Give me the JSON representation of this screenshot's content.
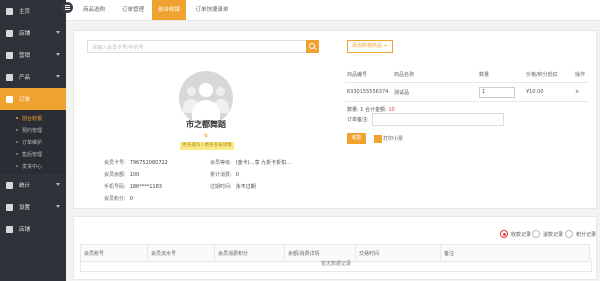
{
  "sidebar": {
    "items": [
      {
        "label": "主页"
      },
      {
        "label": "店铺"
      },
      {
        "label": "营销"
      },
      {
        "label": "产品"
      },
      {
        "label": "订单"
      },
      {
        "label": "统计"
      },
      {
        "label": "设置"
      },
      {
        "label": "店铺"
      }
    ],
    "sub_items": [
      {
        "label": "前台收银"
      },
      {
        "label": "预约管理"
      },
      {
        "label": "订单维护"
      },
      {
        "label": "售后管理"
      },
      {
        "label": "发货中心"
      }
    ]
  },
  "tabs": [
    {
      "label": "商品选购"
    },
    {
      "label": "订单管理"
    },
    {
      "label": "前台收银"
    },
    {
      "label": "订单快捷录单"
    }
  ],
  "search": {
    "placeholder": "请输入会员卡号/手机号"
  },
  "member": {
    "name": "市之都舞蹈",
    "gender": "女",
    "action_label": "更多操作 / 更多会员详情",
    "fields": [
      {
        "label": "会员卡号:",
        "value": "796752080722"
      },
      {
        "label": "会员余额:",
        "value": "100"
      },
      {
        "label": "手机号码:",
        "value": "186****1183"
      },
      {
        "label": "会员积分:",
        "value": "0"
      },
      {
        "label": "会员等级:",
        "value": "(金卡)…享 九折卡折扣…"
      },
      {
        "label": "累计消费:",
        "value": "0"
      },
      {
        "label": "过期时间:",
        "value": "永不过期"
      }
    ]
  },
  "cart": {
    "add_button": "添加购物商品 +",
    "headers": [
      "商品编号",
      "商品名称",
      "数量",
      "价格/积分抵扣",
      "操作"
    ],
    "rows": [
      {
        "code": "6330155556374",
        "name": "测试品",
        "qty": "1",
        "price": "¥10.00",
        "op": "×"
      }
    ],
    "summary_count_label": "数量: 1  合计金额:",
    "summary_total": "10",
    "remark_label": "订单备注:",
    "pay_button": "收款",
    "print_label": "打印小票"
  },
  "records": {
    "radios": [
      {
        "label": "收款记录"
      },
      {
        "label": "退款记录"
      },
      {
        "label": "积分记录"
      }
    ],
    "headers": [
      "会员账号",
      "会员流水号",
      "会员消费积分",
      "余额/消费详情",
      "交易时间",
      "备注"
    ],
    "empty": "暂无数据记录"
  }
}
